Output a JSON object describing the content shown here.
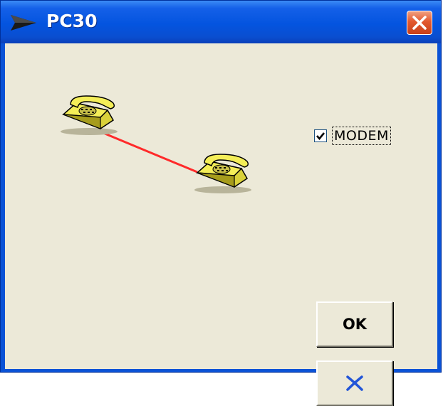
{
  "window": {
    "title": "PC30"
  },
  "options": {
    "modem_label": "MODEM",
    "modem_checked": true
  },
  "buttons": {
    "ok_label": "OK",
    "cancel_icon": "x-icon"
  },
  "diagram": {
    "nodes": [
      "telephone-icon",
      "telephone-icon"
    ],
    "link_color": "#ff2a2a"
  },
  "colors": {
    "titlebar": "#0454df",
    "client_bg": "#ece9d8",
    "close_button": "#e2582e",
    "phone_body": "#f2ec4c",
    "cancel_icon": "#2255d8"
  }
}
